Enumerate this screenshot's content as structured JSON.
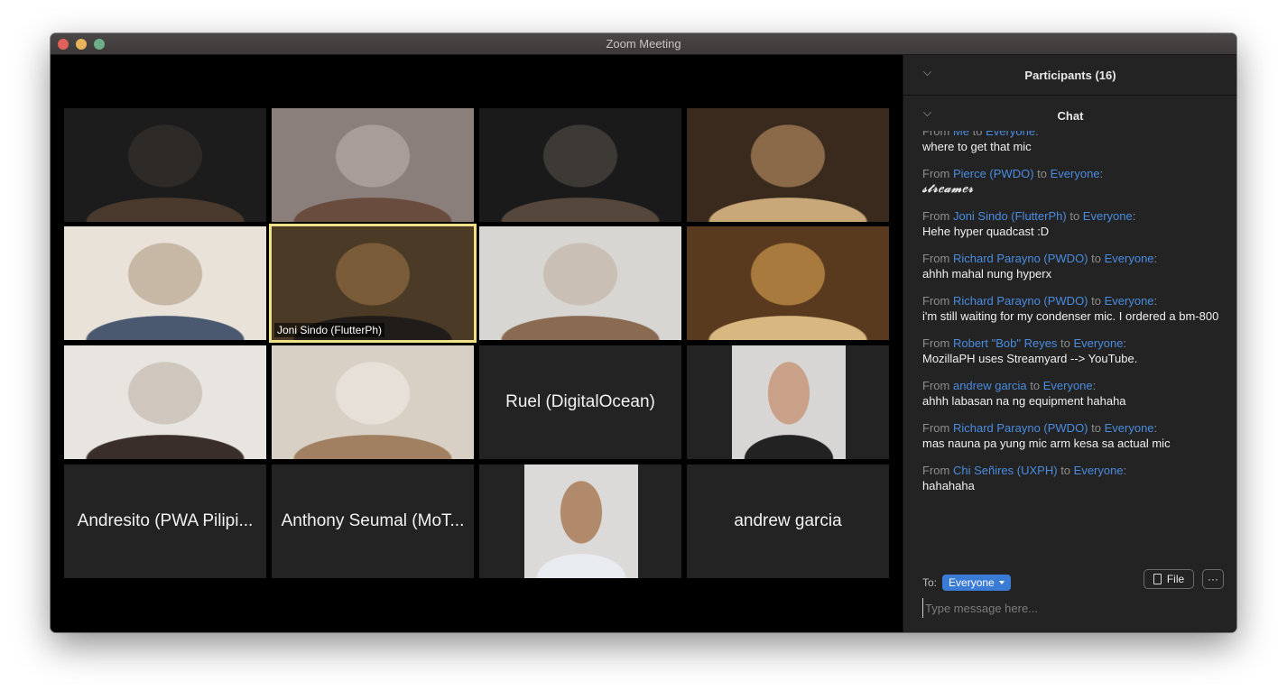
{
  "window": {
    "title": "Zoom Meeting"
  },
  "gallery": {
    "tiles": [
      {
        "type": "video",
        "name": "",
        "colors": [
          "#1c1c1c",
          "#2e2a27",
          "#4a3a2e"
        ]
      },
      {
        "type": "video",
        "name": "",
        "colors": [
          "#8a7f7a",
          "#a89d98",
          "#6a4c3e"
        ]
      },
      {
        "type": "video",
        "name": "",
        "colors": [
          "#1a1a1a",
          "#3d3a36",
          "#55473c"
        ]
      },
      {
        "type": "video",
        "name": "",
        "colors": [
          "#3a2a1e",
          "#8a6a48",
          "#c8a878"
        ]
      },
      {
        "type": "video",
        "name": "",
        "colors": [
          "#e8e2d8",
          "#c7b8a5",
          "#4a5870"
        ]
      },
      {
        "type": "video",
        "name": "Joni Sindo (FlutterPh)",
        "active": true,
        "colors": [
          "#4a3a26",
          "#7a5c38",
          "#1f1c1a"
        ]
      },
      {
        "type": "video",
        "name": "",
        "colors": [
          "#d8d6d2",
          "#c9bfb4",
          "#8a6a50"
        ]
      },
      {
        "type": "video",
        "name": "",
        "colors": [
          "#5a3a1e",
          "#a87a3e",
          "#d8b880"
        ]
      },
      {
        "type": "video",
        "name": "",
        "colors": [
          "#e8e4e0",
          "#cfc6bd",
          "#3a2e2a"
        ]
      },
      {
        "type": "video",
        "name": "",
        "colors": [
          "#d8d0c4",
          "#e6e0d8",
          "#a08060"
        ]
      },
      {
        "type": "name",
        "name": "Ruel (DigitalOcean)"
      },
      {
        "type": "photo",
        "name": "",
        "colors": [
          "#d8d6d4",
          "#c9a088",
          "#222222"
        ]
      },
      {
        "type": "name",
        "name": "Andresito (PWA Pilipi..."
      },
      {
        "type": "name",
        "name": "Anthony Seumal (MoT..."
      },
      {
        "type": "photo",
        "name": "",
        "colors": [
          "#dcdad8",
          "#b08a6a",
          "#e8ecf0"
        ]
      },
      {
        "type": "name",
        "name": "andrew garcia"
      }
    ]
  },
  "panel": {
    "participants_header": "Participants (16)",
    "chat_header": "Chat",
    "messages": [
      {
        "from_prefix": "From",
        "sender": "Me",
        "to_word": "to",
        "recipient": "Everyone",
        "colon": ":",
        "text": "where to get that mic",
        "clipped": true
      },
      {
        "from_prefix": "From",
        "sender": "Pierce (PWDO)",
        "to_word": "to",
        "recipient": "Everyone",
        "colon": ":",
        "text": "𝓈𝓉𝓇𝑒𝒶𝓂𝑒𝓇",
        "script": true
      },
      {
        "from_prefix": "From",
        "sender": "Joni Sindo (FlutterPh)",
        "to_word": "to",
        "recipient": "Everyone",
        "colon": ":",
        "text": "Hehe hyper quadcast :D"
      },
      {
        "from_prefix": "From",
        "sender": "Richard Parayno (PWDO)",
        "to_word": "to",
        "recipient": "Everyone",
        "colon": ":",
        "text": "ahhh mahal nung hyperx"
      },
      {
        "from_prefix": "From",
        "sender": "Richard Parayno (PWDO)",
        "to_word": "to",
        "recipient": "Everyone",
        "colon": ":",
        "text": "i'm still waiting for my condenser mic. I ordered a bm-800"
      },
      {
        "from_prefix": "From",
        "sender": "Robert \"Bob\" Reyes",
        "to_word": "to",
        "recipient": "Everyone",
        "colon": ":",
        "text": "MozillaPH uses Streamyard --> YouTube."
      },
      {
        "from_prefix": "From",
        "sender": "andrew garcia",
        "to_word": "to",
        "recipient": "Everyone",
        "colon": ":",
        "text": "ahhh labasan na ng equipment hahaha"
      },
      {
        "from_prefix": "From",
        "sender": "Richard Parayno (PWDO)",
        "to_word": "to",
        "recipient": "Everyone",
        "colon": ":",
        "text": "mas nauna pa yung mic arm kesa sa actual mic"
      },
      {
        "from_prefix": "From",
        "sender": "Chi Señires (UXPH)",
        "to_word": "to",
        "recipient": "Everyone",
        "colon": ":",
        "text": "hahahaha"
      }
    ],
    "to_label": "To:",
    "to_value": "Everyone",
    "file_label": "File",
    "more_label": "···",
    "input_placeholder": "Type message here...",
    "input_value": ""
  }
}
